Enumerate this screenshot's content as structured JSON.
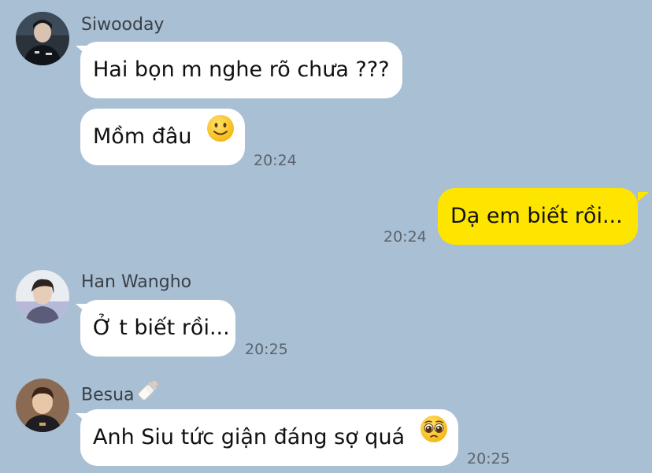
{
  "colors": {
    "background": "#a9bfd3",
    "incoming_bubble": "#ffffff",
    "outgoing_bubble": "#fee500",
    "timestamp": "#5a646e"
  },
  "messages": [
    {
      "sender": "Siwooday",
      "avatar": "profile-photo",
      "texts": [
        "Hai bọn m nghe rõ chưa ???",
        "Mồm đâu"
      ],
      "emoji": "slightly-smiling-face-icon",
      "time": "20:24"
    },
    {
      "sender": "me",
      "text": "Dạ em biết rồi...",
      "time": "20:24"
    },
    {
      "sender": "Han Wangho",
      "avatar": "profile-photo",
      "text": "Ở t biết rồi...",
      "time": "20:25"
    },
    {
      "sender": "Besua",
      "sender_icon": "baby-bottle-icon",
      "avatar": "profile-photo",
      "text": "Anh Siu tức giận đáng sợ quá",
      "emoji": "pleading-face-icon",
      "time": "20:25"
    }
  ]
}
